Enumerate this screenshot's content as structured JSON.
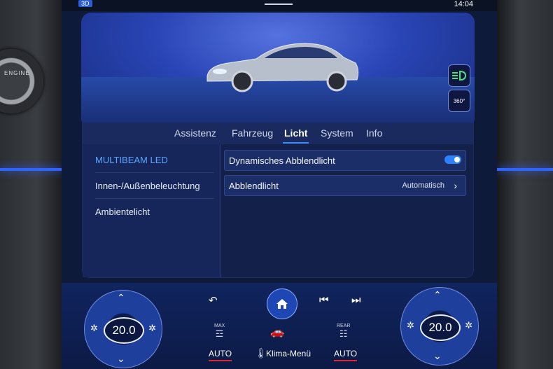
{
  "status": {
    "time": "14:04",
    "badge": "3D"
  },
  "knob": {
    "label": "ENGINE"
  },
  "hero": {
    "buttons": [
      {
        "name": "headlight-icon"
      },
      {
        "name": "view-360-icon",
        "label": "360°"
      }
    ]
  },
  "tabs": [
    "Assistenz",
    "Fahrzeug",
    "Licht",
    "System",
    "Info"
  ],
  "active_tab": "Licht",
  "sidebar": {
    "items": [
      {
        "label": "MULTIBEAM LED",
        "active": true
      },
      {
        "label": "Innen-/Außenbeleuchtung",
        "active": false
      },
      {
        "label": "Ambientelicht",
        "active": false
      }
    ]
  },
  "settings": {
    "dynamic": {
      "label": "Dynamisches Abblendlicht",
      "enabled": true
    },
    "low_beam": {
      "label": "Abblendlicht",
      "value": "Automatisch"
    }
  },
  "climate": {
    "left_temp": "20.0",
    "right_temp": "20.0",
    "left_auto": "AUTO",
    "right_auto": "AUTO",
    "menu_label": "Klima-Menü",
    "max_label": "MAX",
    "rear_label": "REAR"
  },
  "colors": {
    "accent": "#3a8dff",
    "auto_underline": "#e2242f"
  }
}
